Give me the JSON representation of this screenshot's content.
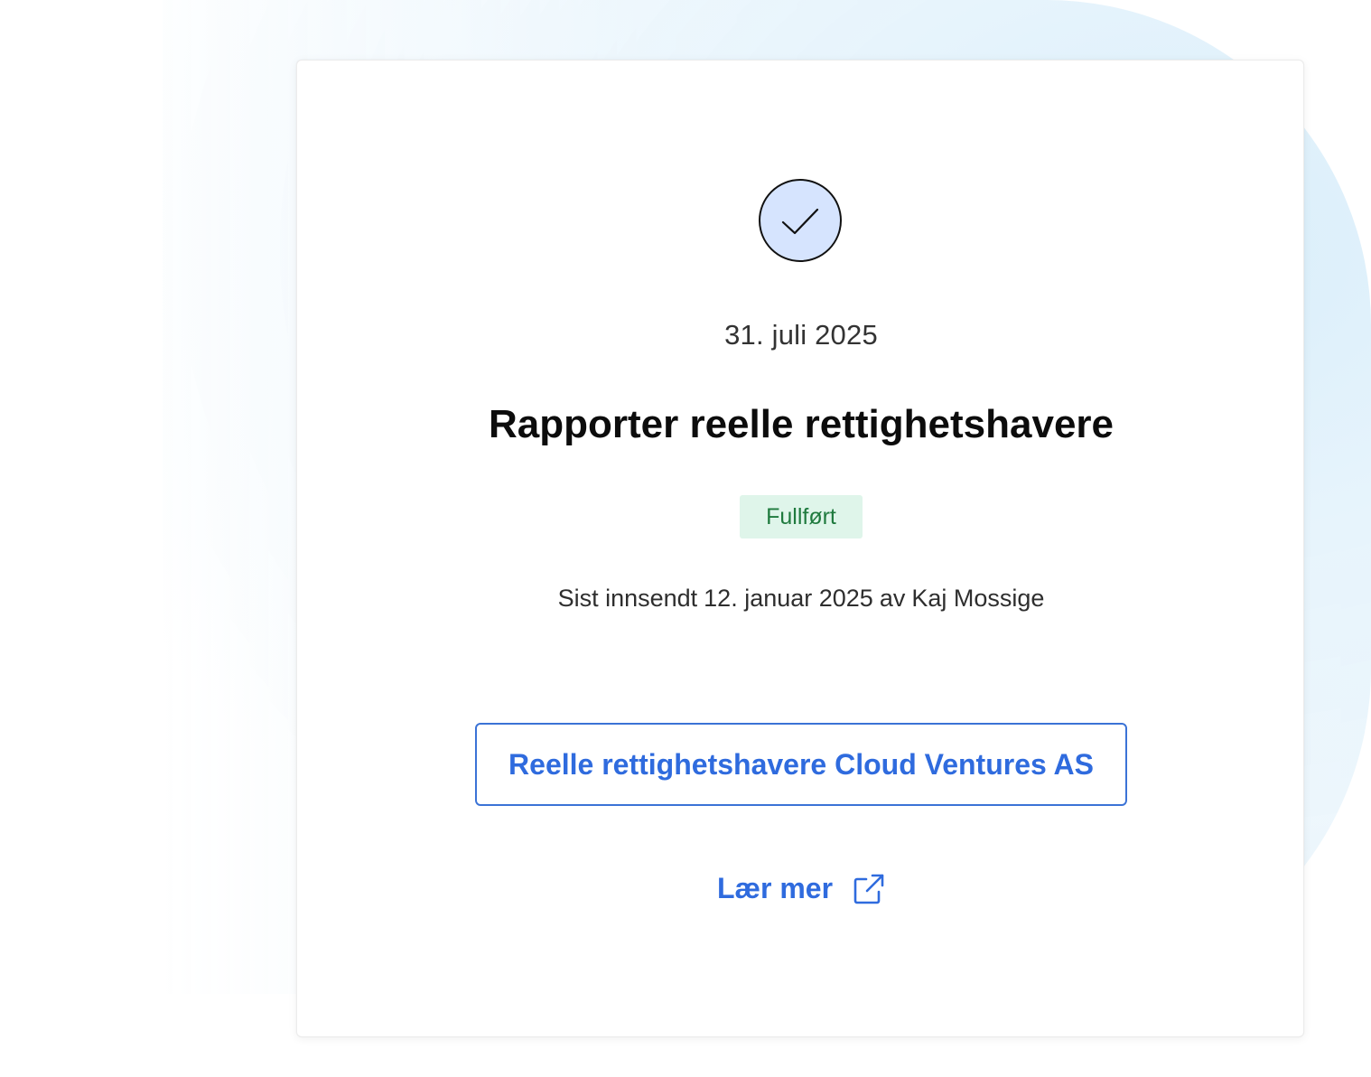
{
  "task": {
    "date": "31. juli 2025",
    "title": "Rapporter reelle rettighetshavere",
    "status": "Fullført",
    "submitted": {
      "prefix": "Sist innsendt",
      "date": "12. januar 2025",
      "by_word": "av",
      "user": "Kaj Mossige"
    },
    "primary_link_label": "Reelle rettighetshavere Cloud Ventures AS",
    "learn_more_label": "Lær mer"
  },
  "icons": {
    "status": "check-icon",
    "external": "external-link-icon"
  },
  "colors": {
    "accent": "#2f6bde",
    "check_circle_fill": "#d6e4fe",
    "badge_bg": "#dff5ea",
    "badge_text": "#1f7a3e"
  }
}
